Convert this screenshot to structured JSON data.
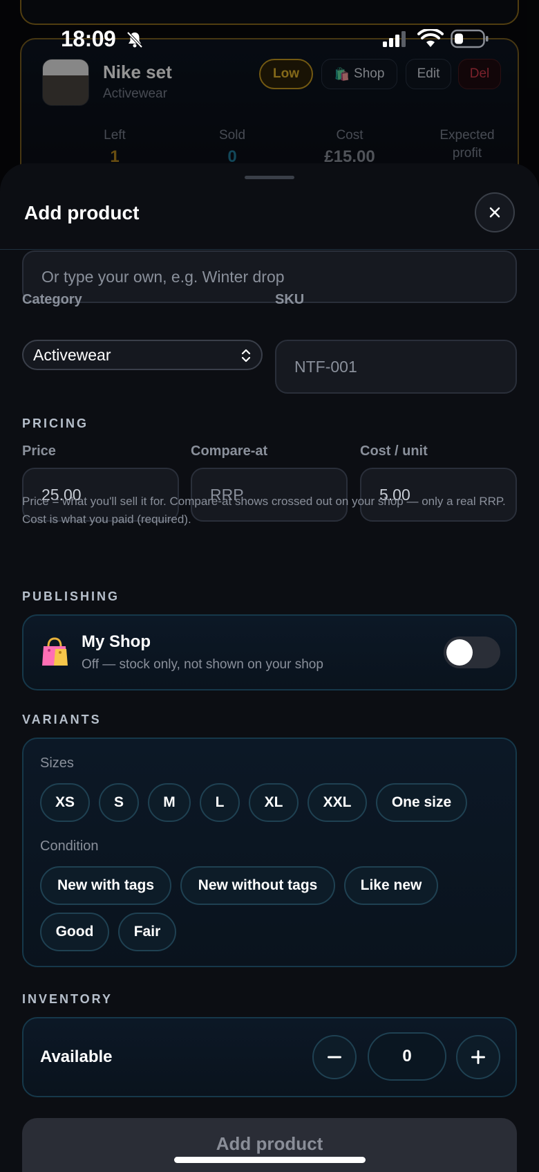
{
  "status_bar": {
    "time": "18:09"
  },
  "background_item": {
    "name": "Nike set",
    "category": "Activewear",
    "badge_low": "Low",
    "shop_button": "Shop",
    "edit_button": "Edit",
    "delete_button": "Del",
    "stats": [
      {
        "label": "Left",
        "value": "1",
        "color": "#b4861c"
      },
      {
        "label": "Sold",
        "value": "0",
        "color": "#1f7a99"
      },
      {
        "label": "Cost",
        "value": "£15.00",
        "color": "#8a8f99"
      },
      {
        "label": "Expected",
        "value": "profit",
        "color": "#6a707a"
      }
    ]
  },
  "sheet": {
    "title": "Add product",
    "collection_placeholder": "Or type your own, e.g. Winter drop",
    "category_label": "Category",
    "category_value": "Activewear",
    "sku_label": "SKU",
    "sku_placeholder": "NTF-001",
    "pricing": {
      "heading": "PRICING",
      "price_label": "Price",
      "price_value": "25.00",
      "compare_label": "Compare-at",
      "compare_placeholder": "RRP",
      "cost_label": "Cost / unit",
      "cost_value": "5.00",
      "help": "Price = what you'll sell it for. Compare-at shows crossed out on your shop — only a real RRP. Cost is what you paid (required)."
    },
    "publishing": {
      "heading": "PUBLISHING",
      "shop_title": "My Shop",
      "shop_subtitle": "Off — stock only, not shown on your shop",
      "enabled": false
    },
    "variants": {
      "heading": "VARIANTS",
      "sizes_label": "Sizes",
      "sizes": [
        "XS",
        "S",
        "M",
        "L",
        "XL",
        "XXL",
        "One size"
      ],
      "condition_label": "Condition",
      "conditions": [
        "New with tags",
        "New without tags",
        "Like new",
        "Good",
        "Fair"
      ]
    },
    "inventory": {
      "heading": "INVENTORY",
      "available_label": "Available",
      "quantity": "0"
    },
    "submit_label": "Add product"
  },
  "colors": {
    "accent_gold": "#c69a1f",
    "danger": "#d33a4a",
    "panel_border": "#16384a"
  }
}
